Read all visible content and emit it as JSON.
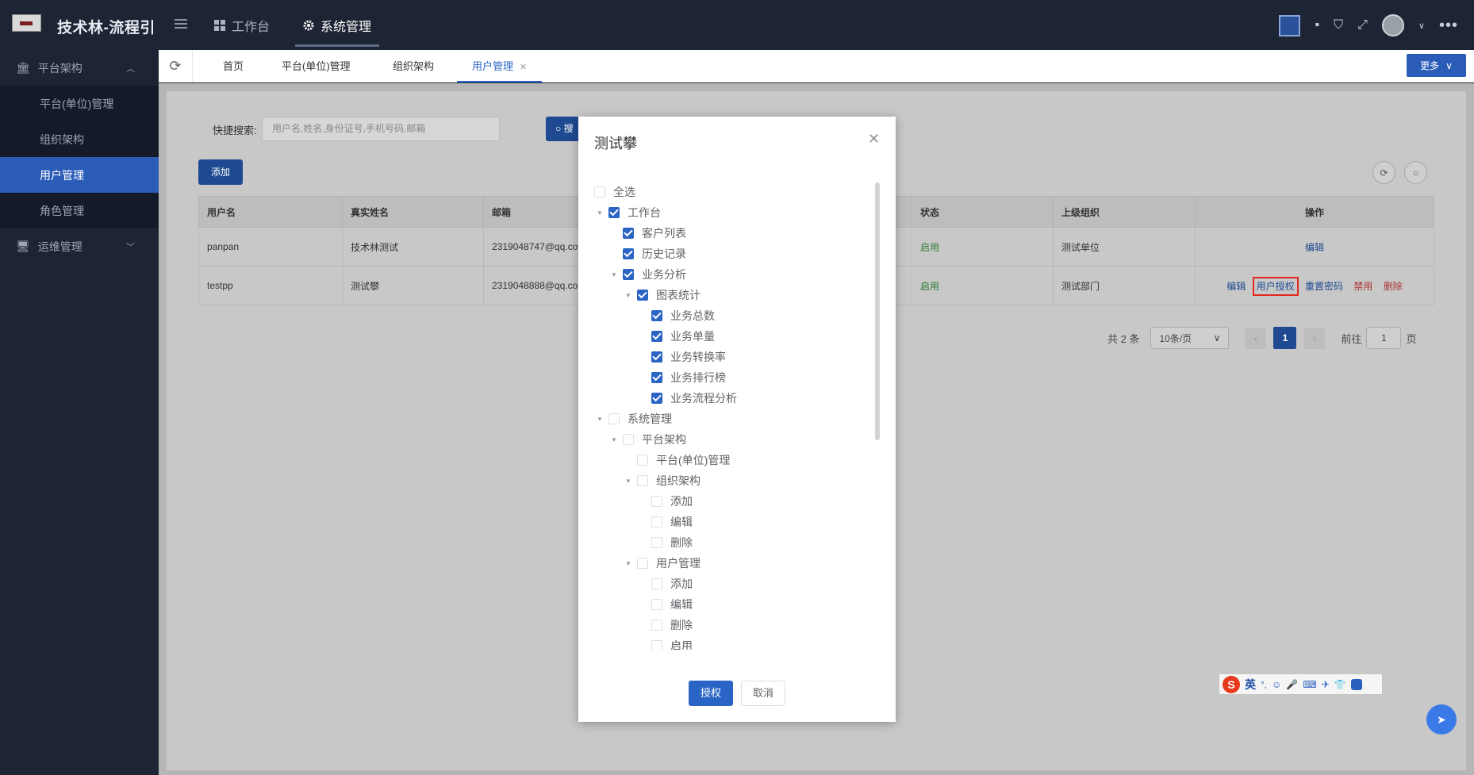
{
  "header": {
    "brand": "技术林-流程引",
    "nav": [
      {
        "label": "工作台"
      },
      {
        "label": "系统管理"
      }
    ]
  },
  "sidebar": {
    "groups": [
      {
        "label": "平台架构",
        "expanded": true,
        "items": [
          {
            "label": "平台(单位)管理"
          },
          {
            "label": "组织架构"
          },
          {
            "label": "用户管理",
            "active": true
          },
          {
            "label": "角色管理"
          }
        ]
      },
      {
        "label": "运维管理",
        "expanded": false
      }
    ]
  },
  "tabs": {
    "items": [
      {
        "label": "首页"
      },
      {
        "label": "平台(单位)管理"
      },
      {
        "label": "组织架构"
      },
      {
        "label": "用户管理",
        "active": true
      }
    ],
    "more_label": "更多"
  },
  "search": {
    "label": "快捷搜索:",
    "placeholder": "用户名,姓名,身份证号,手机号码,邮箱",
    "button_label": "搜"
  },
  "toolbar": {
    "add_label": "添加"
  },
  "table": {
    "headers": [
      "用户名",
      "真实姓名",
      "邮箱",
      "状态",
      "上级组织",
      "操作"
    ],
    "rows": [
      {
        "username": "panpan",
        "realname": "技术林测试",
        "email": "2319048747@qq.co",
        "status": "启用",
        "org": "测试单位",
        "actions": [
          "编辑"
        ]
      },
      {
        "username": "testpp",
        "realname": "测试攀",
        "email": "2319048888@qq.co",
        "status": "启用",
        "org": "测试部门",
        "actions": [
          "编辑",
          "用户授权",
          "重置密码",
          "禁用",
          "删除"
        ]
      }
    ]
  },
  "pagination": {
    "total_text": "共 2 条",
    "page_size": "10条/页",
    "current_page": "1",
    "goto_label": "前往",
    "goto_value": "1",
    "page_suffix": "页"
  },
  "modal": {
    "title": "测试攀",
    "select_all": "全选",
    "tree": [
      {
        "label": "工作台",
        "level": 0,
        "checked": true,
        "caret": true
      },
      {
        "label": "客户列表",
        "level": 1,
        "checked": true
      },
      {
        "label": "历史记录",
        "level": 1,
        "checked": true
      },
      {
        "label": "业务分析",
        "level": 1,
        "checked": true,
        "caret": true
      },
      {
        "label": "图表统计",
        "level": 2,
        "checked": true,
        "caret": true
      },
      {
        "label": "业务总数",
        "level": 3,
        "checked": true
      },
      {
        "label": "业务单量",
        "level": 3,
        "checked": true
      },
      {
        "label": "业务转换率",
        "level": 3,
        "checked": true
      },
      {
        "label": "业务排行榜",
        "level": 3,
        "checked": true
      },
      {
        "label": "业务流程分析",
        "level": 3,
        "checked": true
      },
      {
        "label": "系统管理",
        "level": 0,
        "checked": false,
        "caret": true
      },
      {
        "label": "平台架构",
        "level": 1,
        "checked": false,
        "caret": true
      },
      {
        "label": "平台(单位)管理",
        "level": 2,
        "checked": false
      },
      {
        "label": "组织架构",
        "level": 2,
        "checked": false,
        "caret": true
      },
      {
        "label": "添加",
        "level": 3,
        "checked": false
      },
      {
        "label": "编辑",
        "level": 3,
        "checked": false
      },
      {
        "label": "删除",
        "level": 3,
        "checked": false
      },
      {
        "label": "用户管理",
        "level": 2,
        "checked": false,
        "caret": true
      },
      {
        "label": "添加",
        "level": 3,
        "checked": false
      },
      {
        "label": "编辑",
        "level": 3,
        "checked": false
      },
      {
        "label": "删除",
        "level": 3,
        "checked": false
      },
      {
        "label": "启用",
        "level": 3,
        "checked": false
      }
    ],
    "confirm_label": "授权",
    "cancel_label": "取消"
  },
  "ime": {
    "lang": "英"
  },
  "colors": {
    "primary": "#2a64c5",
    "topbar": "#1d2433",
    "danger": "#e0281f"
  }
}
